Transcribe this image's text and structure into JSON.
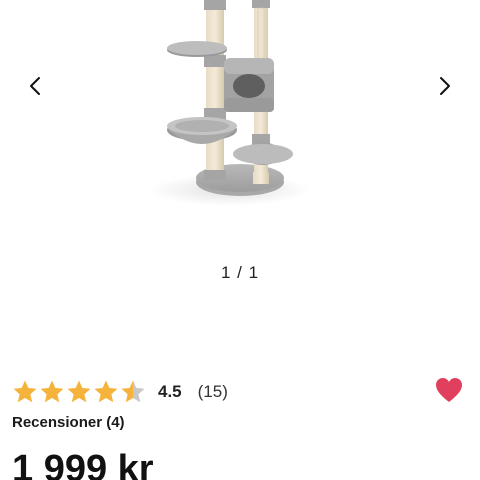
{
  "gallery": {
    "product_image_alt": "cat-tree",
    "prev_icon": "chevron-left-icon",
    "next_icon": "chevron-right-icon",
    "counter": "1 / 1"
  },
  "rating": {
    "value": "4.5",
    "count": "(15)",
    "stars_filled": 4.5,
    "stars_total": 5,
    "star_color": "#F6B33C",
    "star_empty_color": "#C8C8C8"
  },
  "favorite": {
    "icon": "heart-icon",
    "color": "#E0405E"
  },
  "reviews": {
    "label": "Recensioner (4)"
  },
  "price": {
    "text": "1 999 kr"
  }
}
